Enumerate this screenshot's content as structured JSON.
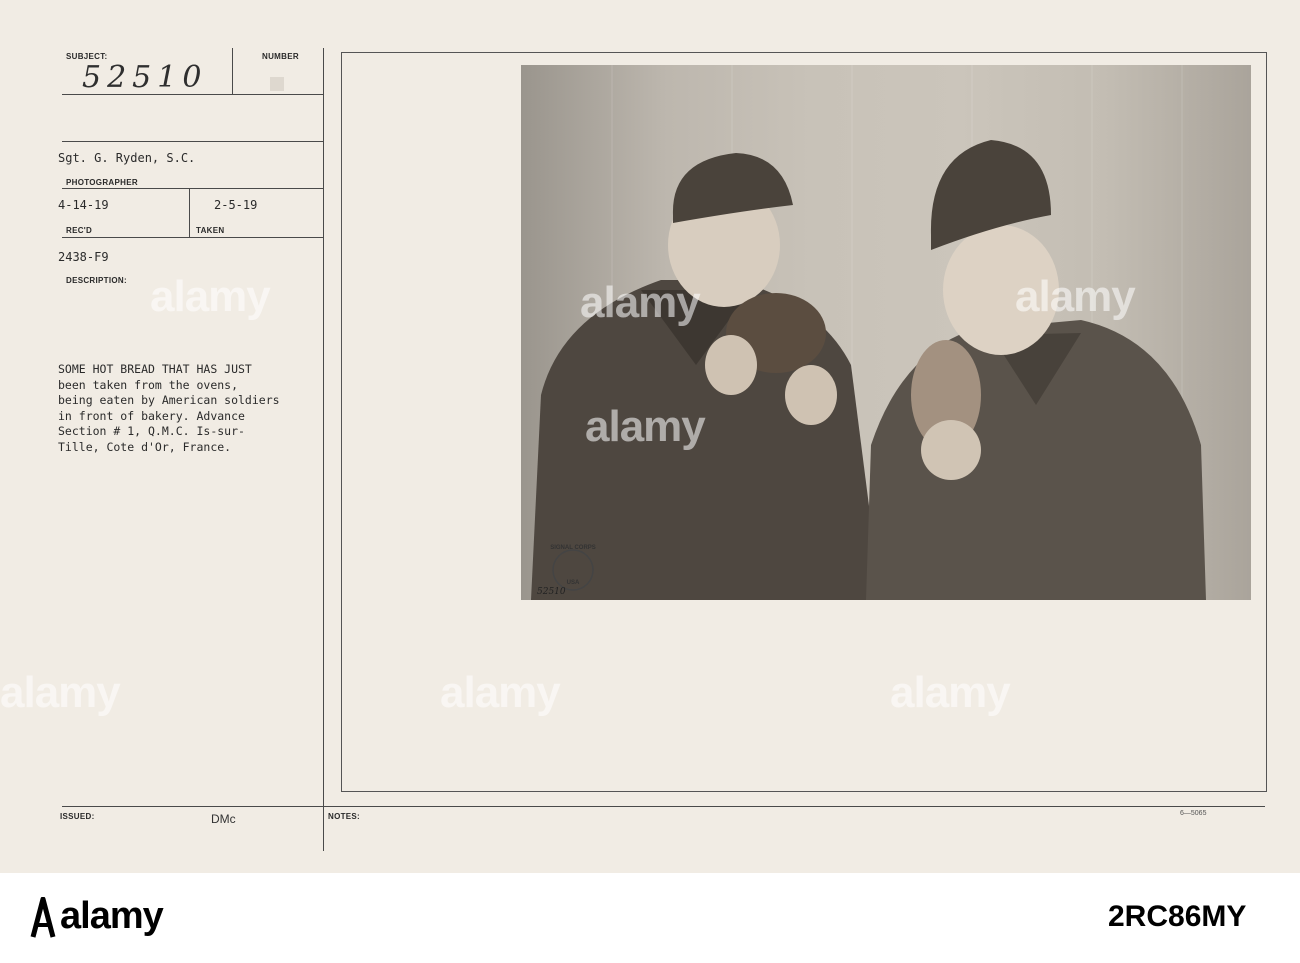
{
  "card": {
    "subject_label": "SUBJECT:",
    "subject_value": "52510",
    "number_label": "NUMBER",
    "photographer_value": "Sgt. G. Ryden, S.C.",
    "photographer_label": "PHOTOGRAPHER",
    "received_value": "4-14-19",
    "received_label": "REC'D",
    "taken_value": "2-5-19",
    "taken_label": "TAKEN",
    "file_code": "2438-F9",
    "description_label": "DESCRIPTION:",
    "description_lines": [
      "SOME HOT BREAD THAT HAS JUST",
      "been taken from the ovens,",
      "being eaten by American soldiers",
      "in front of bakery. Advance",
      "Section # 1, Q.M.C. Is-sur-",
      "Tille, Cote d'Or, France."
    ],
    "issued_label": "ISSUED:",
    "issued_value": "DMc",
    "notes_label": "NOTES:",
    "form_number": "6—5065"
  },
  "photo": {
    "seal_top": "SIGNAL CORPS",
    "seal_bottom": "USA",
    "photo_number": "52510"
  },
  "watermark": {
    "text": "alamy"
  },
  "footer": {
    "brand": "alamy",
    "image_code": "2RC86MY"
  },
  "colors": {
    "card_bg": "#f1ece4",
    "ink": "#2b2b2b"
  }
}
